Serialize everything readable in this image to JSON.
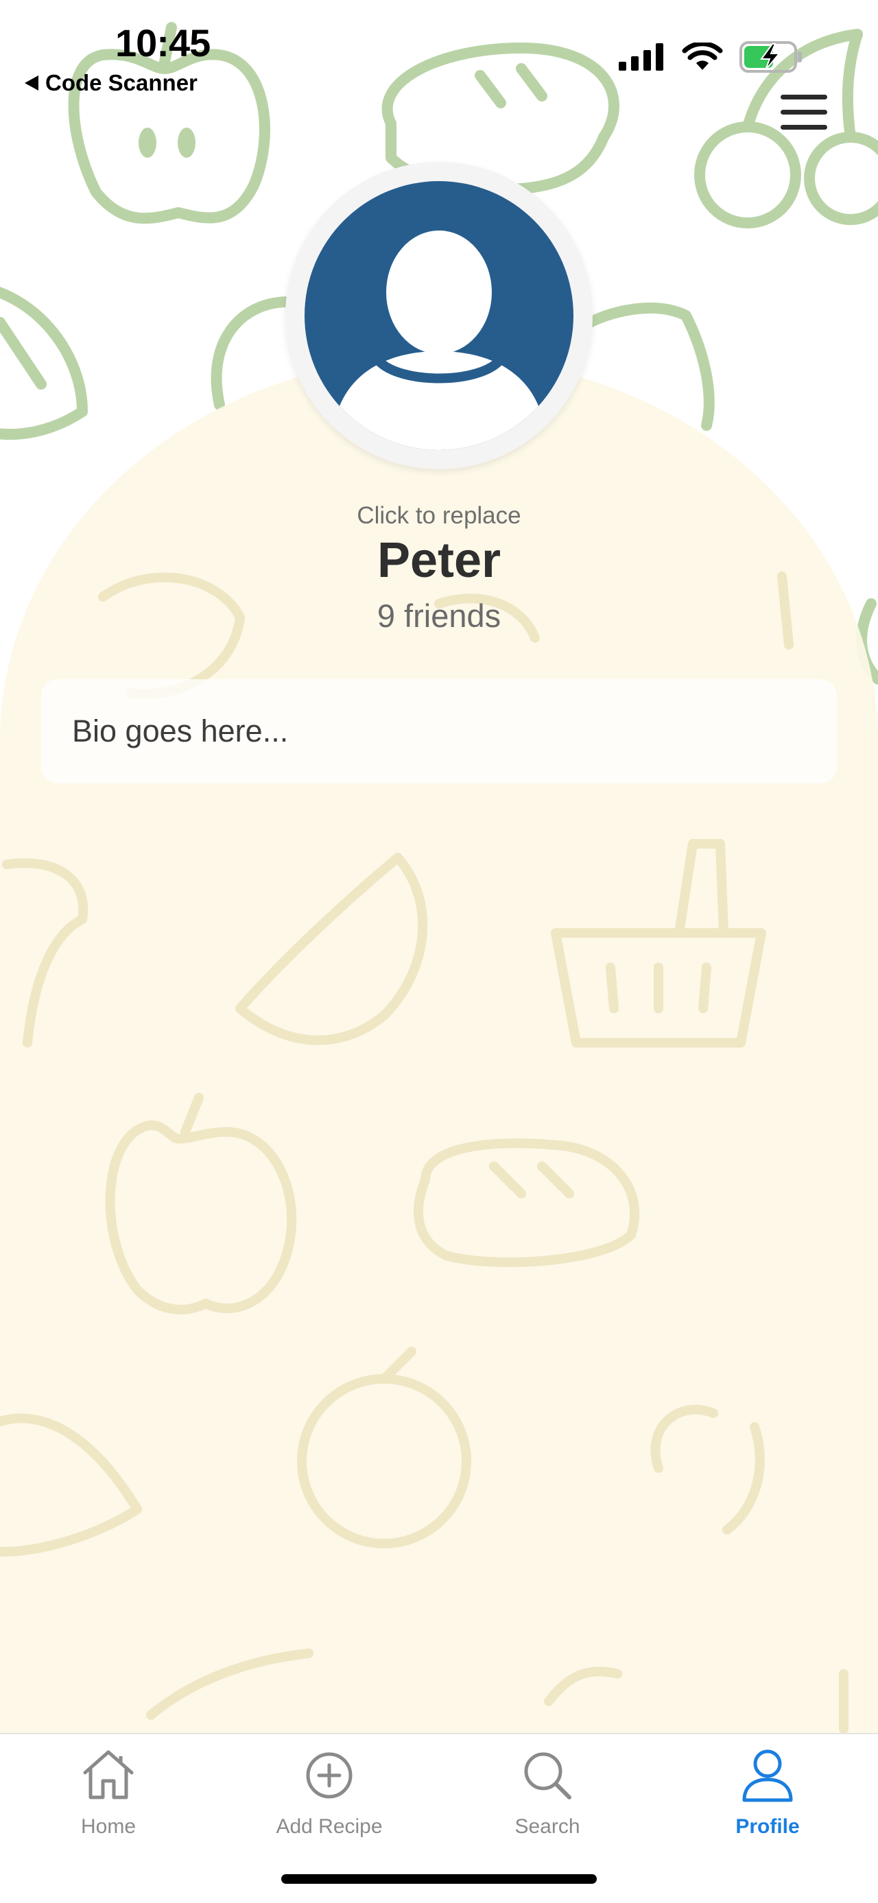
{
  "status_bar": {
    "time": "10:45",
    "back_app_label": "Code Scanner",
    "icons": [
      "cellular-signal-icon",
      "wifi-icon",
      "battery-charging-icon"
    ]
  },
  "header": {
    "menu_icon": "hamburger-menu-icon"
  },
  "profile": {
    "avatar_icon": "default-user-avatar-icon",
    "replace_hint": "Click to replace",
    "name": "Peter",
    "friends": "9 friends",
    "bio_placeholder": "Bio goes here..."
  },
  "tab_bar": {
    "active": "Profile",
    "tabs": [
      {
        "label": "Home",
        "icon": "house-icon"
      },
      {
        "label": "Add Recipe",
        "icon": "plus-circle-icon"
      },
      {
        "label": "Search",
        "icon": "magnifier-icon"
      },
      {
        "label": "Profile",
        "icon": "person-icon"
      }
    ]
  },
  "colors": {
    "accent": "#1a7ee0",
    "avatar_bg": "#265d8d",
    "doodle_green": "#b9d3a6",
    "panel_cream": "#fdf8e6",
    "inactive_tab": "#8a8a8a"
  }
}
